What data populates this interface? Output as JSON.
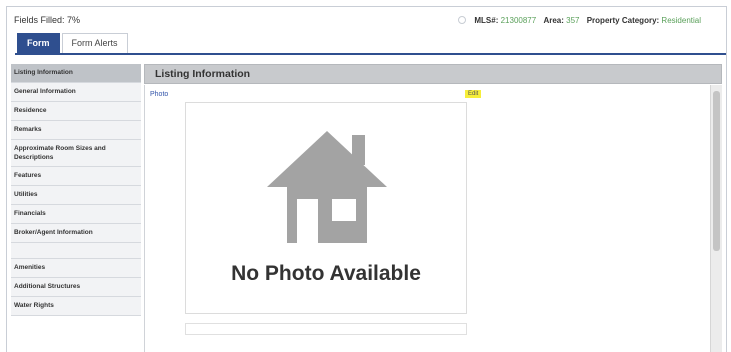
{
  "header": {
    "fields_filled": "Fields Filled: 7%",
    "mls_label": "MLS#:",
    "mls_value": "21300877",
    "area_label": "Area:",
    "area_value": "357",
    "category_label": "Property Category:",
    "category_value": "Residential"
  },
  "tabs": [
    {
      "label": "Form"
    },
    {
      "label": "Form Alerts"
    }
  ],
  "sidebar": {
    "items": [
      {
        "label": "Listing Information"
      },
      {
        "label": "General Information"
      },
      {
        "label": "Residence"
      },
      {
        "label": "Remarks"
      },
      {
        "label": "Approximate Room Sizes and Descriptions"
      },
      {
        "label": "Features"
      },
      {
        "label": "Utilities"
      },
      {
        "label": "Financials"
      },
      {
        "label": "Broker/Agent Information"
      },
      {
        "label": "Amenities"
      },
      {
        "label": "Additional Structures"
      },
      {
        "label": "Water Rights"
      }
    ]
  },
  "main": {
    "section_title": "Listing Information",
    "photo_link": "Photo",
    "edit_label": "Edit",
    "no_photo_text": "No Photo Available"
  },
  "colors": {
    "tab_active": "#2f4f8f",
    "meta_value": "#5aa05a",
    "edit_highlight": "#f6ee3a"
  }
}
